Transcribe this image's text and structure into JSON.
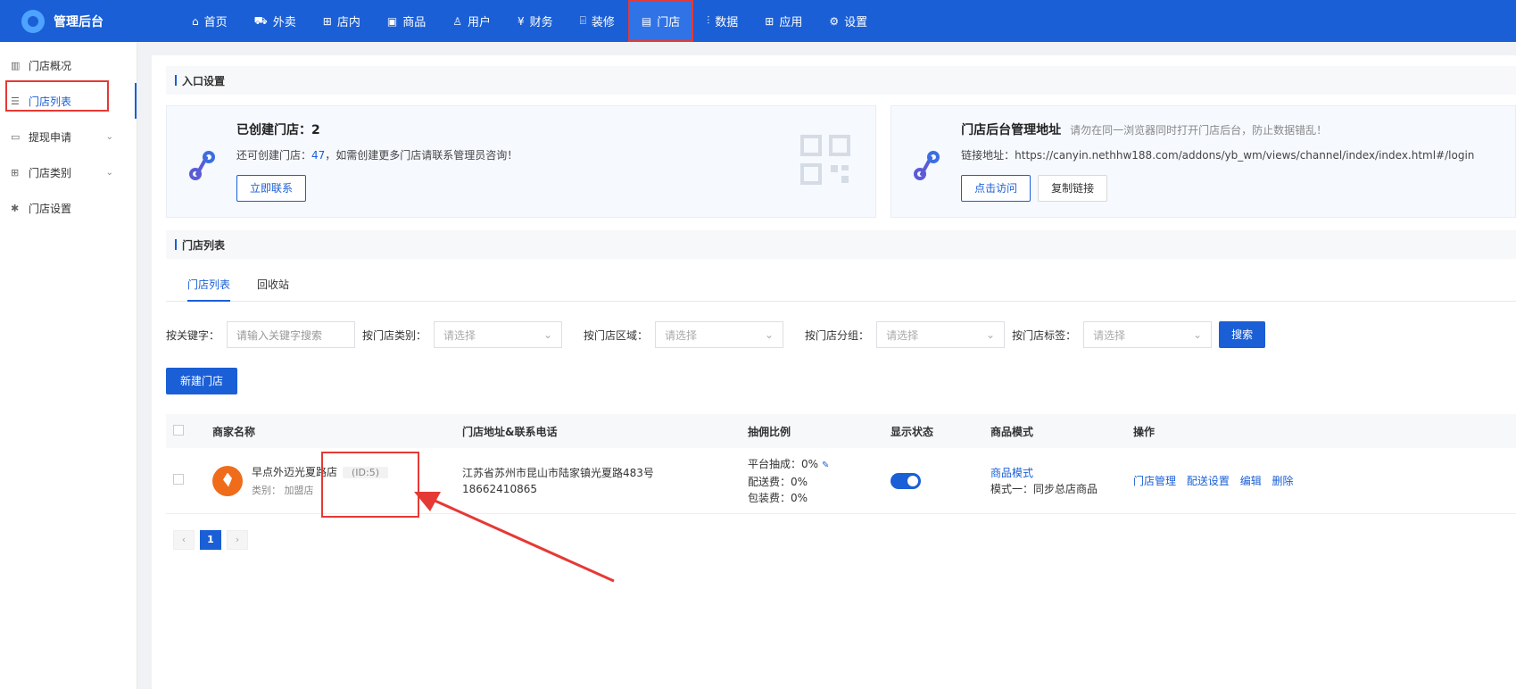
{
  "app": {
    "title": "管理后台"
  },
  "nav": [
    {
      "icon": "home-icon",
      "glyph": "⌂",
      "label": "首页"
    },
    {
      "icon": "delivery-icon",
      "glyph": "⛟",
      "label": "外卖"
    },
    {
      "icon": "dine-in-icon",
      "glyph": "⊞",
      "label": "店内"
    },
    {
      "icon": "goods-icon",
      "glyph": "▣",
      "label": "商品"
    },
    {
      "icon": "user-icon",
      "glyph": "♙",
      "label": "用户"
    },
    {
      "icon": "finance-icon",
      "glyph": "¥",
      "label": "财务"
    },
    {
      "icon": "decorate-icon",
      "glyph": "⌸",
      "label": "装修"
    },
    {
      "icon": "store-icon",
      "glyph": "▤",
      "label": "门店",
      "active": true
    },
    {
      "icon": "chart-icon",
      "glyph": "⫶",
      "label": "数据"
    },
    {
      "icon": "apps-icon",
      "glyph": "⊞",
      "label": "应用"
    },
    {
      "icon": "settings-icon",
      "glyph": "⚙",
      "label": "设置"
    }
  ],
  "sidebar": [
    {
      "icon": "bar-chart-icon",
      "glyph": "▥",
      "label": "门店概况"
    },
    {
      "icon": "list-search-icon",
      "glyph": "☰",
      "label": "门店列表",
      "active": true
    },
    {
      "icon": "calendar-icon",
      "glyph": "▭",
      "label": "提现申请",
      "expandable": true
    },
    {
      "icon": "grid-icon",
      "glyph": "⊞",
      "label": "门店类别",
      "expandable": true
    },
    {
      "icon": "gear-icon",
      "glyph": "✱",
      "label": "门店设置"
    }
  ],
  "entry": {
    "section_title": "入口设置",
    "left": {
      "title_prefix": "已创建门店：",
      "created_count": "2",
      "text_prefix": "还可创建门店：",
      "remaining": "47",
      "text_suffix": "，如需创建更多门店请联系管理员咨询！",
      "button": "立即联系"
    },
    "right": {
      "title": "门店后台管理地址",
      "hint": "请勿在同一浏览器同时打开门店后台，防止数据错乱！",
      "link_label": "链接地址：",
      "link_url": "https://canyin.nethhw188.com/addons/yb_wm/views/channel/index/index.html#/login",
      "visit_button": "点击访问",
      "copy_button": "复制链接"
    }
  },
  "list": {
    "section_title": "门店列表",
    "tabs": [
      "门店列表",
      "回收站"
    ],
    "filters": {
      "keyword_label": "按关键字：",
      "keyword_placeholder": "请输入关键字搜索",
      "category_label": "按门店类别：",
      "region_label": "按门店区域：",
      "group_label": "按门店分组：",
      "tag_label": "按门店标签：",
      "select_placeholder": "请选择",
      "search_button": "搜索"
    },
    "new_button": "新建门店",
    "columns": [
      "商家名称",
      "门店地址&联系电话",
      "抽佣比例",
      "显示状态",
      "商品模式",
      "操作"
    ],
    "rows": [
      {
        "name": "早点外迈光夏路店",
        "id_tag": "(ID:5)",
        "category": "类别：  加盟店",
        "address": "江苏省苏州市昆山市陆家镇光夏路483号",
        "phone": "18662410865",
        "platform_fee": "平台抽成：0%",
        "delivery_fee": "配送费：0%",
        "package_fee": "包装费：0%",
        "status_on": true,
        "mode_link": "商品模式",
        "mode_desc": "模式一：同步总店商品",
        "ops": [
          "门店管理",
          "配送设置",
          "编辑",
          "删除"
        ]
      }
    ],
    "pager": {
      "prev": "‹",
      "current": "1",
      "next": "›"
    }
  }
}
